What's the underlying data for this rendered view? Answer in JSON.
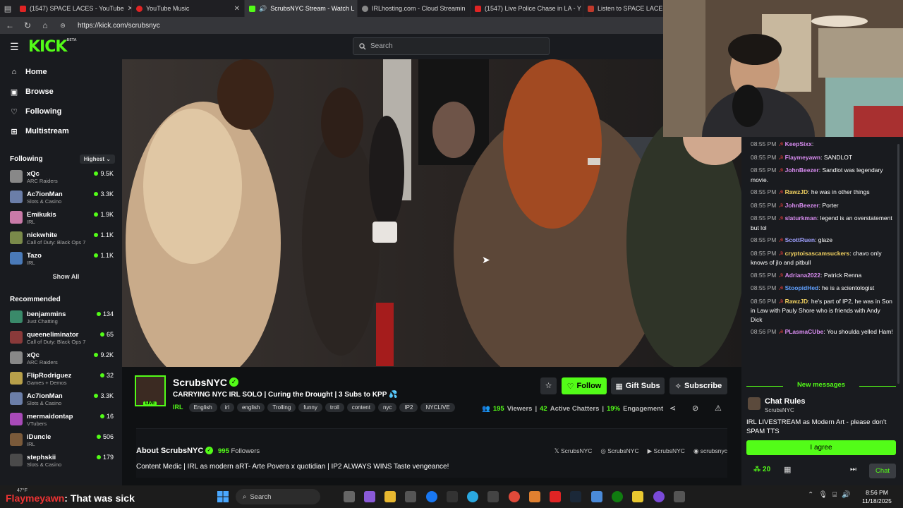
{
  "browser": {
    "tabs": [
      {
        "label": "(1547) SPACE LACES - YouTube",
        "color": "#e02424"
      },
      {
        "label": "YouTube Music",
        "color": "#e02424"
      },
      {
        "label": "ScrubsNYC Stream - Watch L",
        "color": "#53fc18"
      },
      {
        "label": "IRLhosting.com - Cloud Streamin",
        "color": "#888888"
      },
      {
        "label": "(1547) Live Police Chase in LA - Y",
        "color": "#e02424"
      },
      {
        "label": "Listen to SPACE LACES's",
        "color": "#c0392b"
      }
    ],
    "url": "https://kick.com/scrubsnyc"
  },
  "header": {
    "logo": "KICK",
    "logo_tag": "BETA",
    "search_placeholder": "Search"
  },
  "sidebar": {
    "nav": [
      {
        "label": "Home",
        "icon": "home-icon"
      },
      {
        "label": "Browse",
        "icon": "browse-icon"
      },
      {
        "label": "Following",
        "icon": "heart-icon"
      },
      {
        "label": "Multistream",
        "icon": "grid-icon"
      }
    ],
    "following_title": "Following",
    "sort_label": "Highest",
    "following": [
      {
        "name": "xQc",
        "game": "ARC Raiders",
        "viewers": "9.5K",
        "color": "#888888"
      },
      {
        "name": "Ac7ionMan",
        "game": "Slots & Casino",
        "viewers": "3.3K",
        "color": "#6b7ea8"
      },
      {
        "name": "Emikukis",
        "game": "IRL",
        "viewers": "1.9K",
        "color": "#c97aa8"
      },
      {
        "name": "nickwhite",
        "game": "Call of Duty: Black Ops 7",
        "viewers": "1.1K",
        "color": "#7a8a4a"
      },
      {
        "name": "Tazo",
        "game": "IRL",
        "viewers": "1.1K",
        "color": "#4a7ab8"
      }
    ],
    "show_all": "Show All",
    "recommended_title": "Recommended",
    "recommended": [
      {
        "name": "benjammins",
        "game": "Just Chatting",
        "viewers": "134",
        "color": "#3a8a6a"
      },
      {
        "name": "queeneliminator",
        "game": "Call of Duty: Black Ops 7",
        "viewers": "65",
        "color": "#8a3a3a"
      },
      {
        "name": "xQc",
        "game": "ARC Raiders",
        "viewers": "9.2K",
        "color": "#888888"
      },
      {
        "name": "FlipRodriguez",
        "game": "Games + Demos",
        "viewers": "32",
        "color": "#b8a04a"
      },
      {
        "name": "Ac7ionMan",
        "game": "Slots & Casino",
        "viewers": "3.3K",
        "color": "#6b7ea8"
      },
      {
        "name": "mermaidontap",
        "game": "VTubers",
        "viewers": "16",
        "color": "#a84ab8"
      },
      {
        "name": "iDuncle",
        "game": "IRL",
        "viewers": "506",
        "color": "#7a5a3a"
      },
      {
        "name": "stephskii",
        "game": "Slots & Casino",
        "viewers": "179",
        "color": "#4a4a4a"
      }
    ]
  },
  "channel": {
    "name": "ScrubsNYC",
    "live_badge": "LIVE",
    "title": "CARRYING NYC IRL SOLO | Curing the Drought | 3 Subs to KPP",
    "category": "IRL",
    "tags": [
      "English",
      "irl",
      "english",
      "Trolling",
      "funny",
      "troll",
      "content",
      "nyc",
      "IP2",
      "NYCLIVE"
    ],
    "follow_label": "Follow",
    "gift_label": "Gift Subs",
    "subscribe_label": "Subscribe",
    "viewers": "195",
    "viewers_label": "Viewers",
    "chatters": "42",
    "chatters_label": "Active Chatters",
    "engagement": "19%",
    "engagement_label": "Engagement",
    "about_title": "About ScrubsNYC",
    "followers": "995",
    "followers_label": "Followers",
    "socials": [
      {
        "icon": "x-icon",
        "label": "ScrubsNYC",
        "glyph": "𝕏"
      },
      {
        "icon": "instagram-icon",
        "label": "ScrubsNYC",
        "glyph": "◎"
      },
      {
        "icon": "youtube-icon",
        "label": "ScrubsNYC",
        "glyph": "▶"
      },
      {
        "icon": "discord-icon",
        "label": "scrubsnyc",
        "glyph": "◉"
      }
    ],
    "bio": "Content Medic | IRL as modern aRT- Arte Povera x quotidian | IP2 ALWAYS WINS Taste vengeance!"
  },
  "chat": {
    "messages": [
      {
        "time": "08:55 PM",
        "user": "KeepSixx",
        "color": "#d88cf0",
        "text": ""
      },
      {
        "time": "08:55 PM",
        "user": "Flaymeyawn",
        "color": "#d88cf0",
        "text": "SANDLOT"
      },
      {
        "time": "08:55 PM",
        "user": "JohnBeezer",
        "color": "#d88cf0",
        "text": "Sandlot was legendary movie."
      },
      {
        "time": "08:55 PM",
        "user": "RawzJD",
        "color": "#f0d060",
        "text": "he was in other things"
      },
      {
        "time": "08:55 PM",
        "user": "JohnBeezer",
        "color": "#d88cf0",
        "text": "Porter"
      },
      {
        "time": "08:55 PM",
        "user": "slaturkman",
        "color": "#d88cf0",
        "text": "legend is an overstatement but lol"
      },
      {
        "time": "08:55 PM",
        "user": "ScottRuen",
        "color": "#9fa0ff",
        "text": "glaze"
      },
      {
        "time": "08:55 PM",
        "user": "cryptoisascamsuckers",
        "color": "#f0d060",
        "text": "chavo only knows of jlo and pitbull"
      },
      {
        "time": "08:55 PM",
        "user": "Adriana2022",
        "color": "#d88cf0",
        "text": "Patrick Renna"
      },
      {
        "time": "08:55 PM",
        "user": "StoopidHed",
        "color": "#60a0ff",
        "text": "he is a scientologist"
      },
      {
        "time": "08:56 PM",
        "user": "RawzJD",
        "color": "#f0d060",
        "text": "he's part of IP2, he was in Son in Law with Pauly Shore who is friends with Andy Dick"
      },
      {
        "time": "08:56 PM",
        "user": "PLasmaCUbe",
        "color": "#d88cf0",
        "text": "You shoulda yelled Ham!"
      }
    ],
    "new_messages": "New messages",
    "rules_title": "Chat Rules",
    "rules_channel": "ScrubsNYC",
    "rules_text": "IRL LIVESTREAM as Modern Art - please don't SPAM TTS",
    "agree_label": "I agree",
    "points": "20",
    "chat_button": "Chat"
  },
  "taskbar": {
    "overlay_user": "Flaymeyawn",
    "overlay_text": ": That was sick",
    "weather": "47°F",
    "search_label": "Search",
    "time": "8:56 PM",
    "date": "11/18/2025"
  }
}
